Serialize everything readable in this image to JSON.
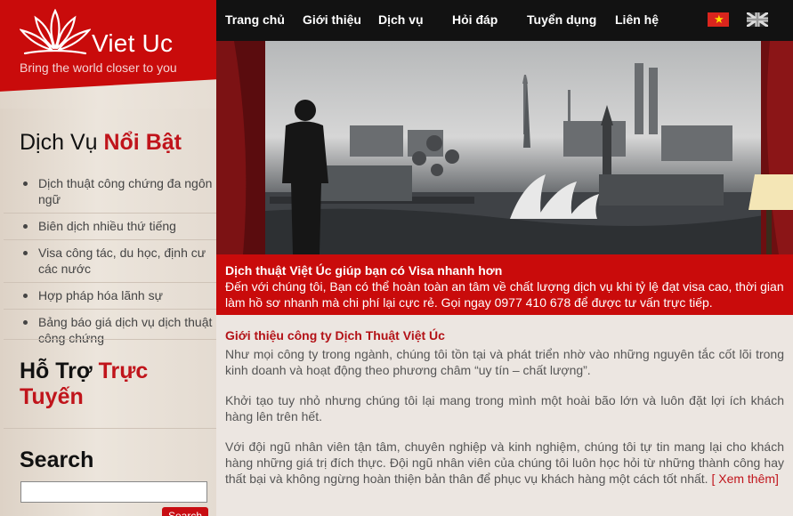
{
  "brand": {
    "name": "Viet Uc",
    "tagline": "Bring the world closer to you"
  },
  "nav": {
    "items": [
      "Trang chủ",
      "Giới thiệu",
      "Dịch vụ",
      "Hỏi đáp",
      "Tuyển dụng",
      "Liên hệ"
    ],
    "languages": [
      "vi-flag-icon",
      "uk-flag-icon"
    ]
  },
  "sidebar": {
    "featured_title_a": "Dịch Vụ ",
    "featured_title_b": "Nổi Bật",
    "featured_items": [
      "Dịch thuật công chứng đa ngôn ngữ",
      "Biên dịch nhiều thứ tiếng",
      "Visa công tác, du học, định cư các nước",
      "Hợp pháp hóa lãnh sự",
      "Bảng báo giá dịch vụ dịch thuật công chứng"
    ],
    "support_title_a": "Hỗ Trợ ",
    "support_title_b": "Trực Tuyến",
    "search_title": "Search",
    "search_value": "",
    "search_button": "Search"
  },
  "infobar": {
    "title": "Dịch thuật Việt Úc giúp bạn có Visa nhanh hơn",
    "text": "Đến với chúng tôi, Bạn có thể hoàn toàn an tâm về chất lượng dịch vụ khi tỷ lệ đạt visa cao, thời gian làm hồ sơ nhanh mà chi phí lại cực rẻ. Gọi ngay 0977 410 678 để được tư vấn trực tiếp."
  },
  "main": {
    "title": "Giới thiệu công ty Dịch Thuật Việt Úc",
    "paragraphs": [
      "Như mọi công ty trong ngành, chúng tôi tồn tại và phát triển nhờ vào những nguyên tắc cốt lõi trong kinh doanh và hoạt động theo phương châm “uy tín – chất lượng”.",
      "Khởi tạo tuy nhỏ nhưng chúng tôi lại mang trong mình một hoài bão lớn và luôn đặt lợi ích khách hàng lên trên hết.",
      "Với đội ngũ nhân viên tận tâm, chuyên nghiệp và kinh nghiệm, chúng tôi tự tin mang lại cho khách hàng những giá trị đích thực. Đội ngũ nhân viên của chúng tôi luôn học hỏi từ những thành công hay thất bại và không ngừng hoàn thiện bản thân để phục vụ khách hàng một cách tốt nhất."
    ],
    "more_link": "[ Xem thêm]"
  },
  "colors": {
    "brand_red": "#c90b0b",
    "nav_bg": "#121212",
    "heading_red": "#c0141b"
  }
}
